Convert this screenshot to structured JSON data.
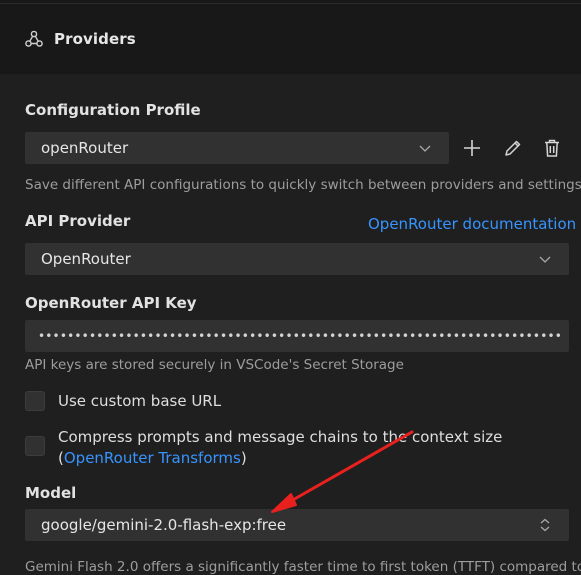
{
  "header": {
    "title": "Providers",
    "icon": "providers-webhook-icon"
  },
  "config_profile": {
    "label": "Configuration Profile",
    "selected": "openRouter",
    "description": "Save different API configurations to quickly switch between providers and settings.",
    "actions": [
      "add-icon",
      "edit-icon",
      "delete-icon"
    ]
  },
  "api_provider": {
    "label": "API Provider",
    "doc_link": "OpenRouter documentation",
    "selected": "OpenRouter"
  },
  "api_key": {
    "label": "OpenRouter API Key",
    "masked_value": "••••••••••••••••••••••••••••••••••••••••••••••••••••••••••••••••••••••••",
    "description": "API keys are stored securely in VSCode's Secret Storage"
  },
  "options": {
    "custom_base_url": "Use custom base URL",
    "compress_line1": "Compress prompts and message chains to the context size",
    "compress_open": "(",
    "compress_link": "OpenRouter Transforms",
    "compress_close": ")"
  },
  "model": {
    "label": "Model",
    "selected": "google/gemini-2.0-flash-exp:free",
    "description": "Gemini Flash 2.0 offers a significantly faster time to first token (TTFT) compared to"
  },
  "colors": {
    "background": "#1f1f1f",
    "header_bg": "#181818",
    "input_bg": "#313131",
    "link": "#3794ff",
    "annotation_arrow": "#e8211f"
  }
}
